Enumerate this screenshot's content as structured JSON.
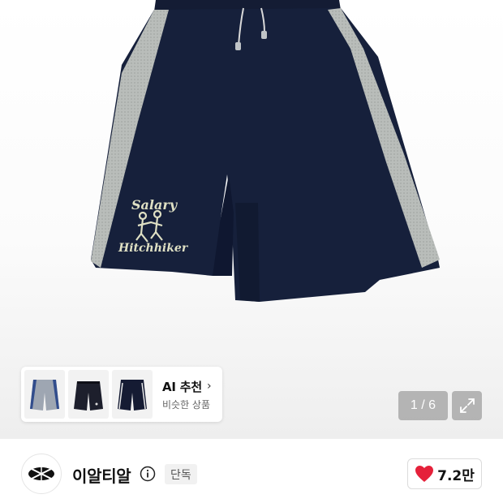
{
  "product": {
    "image_alt": "navy shorts with grey mesh side panels",
    "embroidery_line1": "Salary",
    "embroidery_line2": "Hitchhiker"
  },
  "ai_recommend": {
    "title": "AI 추천",
    "chevron": "›",
    "subtitle": "비슷한 상품",
    "thumbnails": [
      "thumb-grey-shorts",
      "thumb-black-shorts",
      "thumb-navy-stripe-shorts"
    ]
  },
  "gallery": {
    "counter": "1 / 6",
    "expand_icon": "expand-icon"
  },
  "brand": {
    "name": "이알티알",
    "badge": "단독",
    "info_icon": "info-icon",
    "logo_icon": "brand-logo-icon"
  },
  "like": {
    "count": "7.2만",
    "icon": "heart-icon",
    "color": "#e5213a"
  },
  "colors": {
    "navy": "#16203b",
    "mesh_grey": "#b8bcb9",
    "embroidery": "#dfe0c4"
  }
}
